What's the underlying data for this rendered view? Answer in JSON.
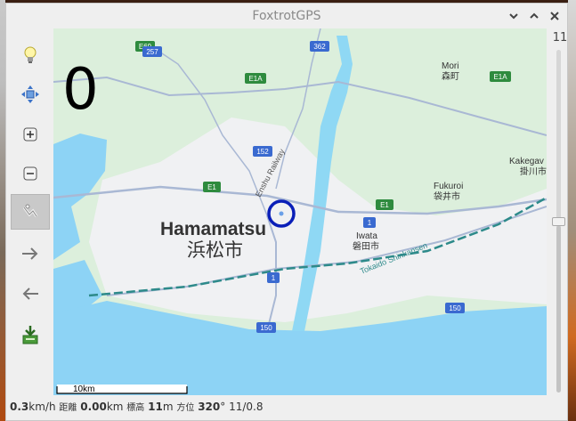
{
  "window": {
    "title": "FoxtrotGPS",
    "controls": [
      "minimize-icon",
      "maximize-icon",
      "close-icon"
    ]
  },
  "toolbar": {
    "items": [
      {
        "name": "bulb-icon"
      },
      {
        "name": "autocenter-icon"
      },
      {
        "name": "zoom-in-icon"
      },
      {
        "name": "zoom-out-icon"
      },
      {
        "name": "fullscreen-icon",
        "active": true
      },
      {
        "name": "forward-arrow-icon"
      },
      {
        "name": "back-arrow-icon"
      },
      {
        "name": "download-icon"
      }
    ]
  },
  "map": {
    "speed_overlay": "0",
    "scale_label": "10km",
    "labels": {
      "hamamatsu_en": "Hamamatsu",
      "hamamatsu_jp": "浜松市",
      "mori_en": "Mori",
      "mori_jp": "森町",
      "kakegawa_en": "Kakegav",
      "kakegawa_jp": "掛川市",
      "fukuroi_en": "Fukuroi",
      "fukuroi_jp": "袋井市",
      "iwata_en": "Iwata",
      "iwata_jp": "磐田市",
      "railway": "Enshu Railway",
      "shinkansen": "Tokaido Shinkansen"
    },
    "route_shields": {
      "r257": "257",
      "r362": "362",
      "r152": "152",
      "r150a": "150",
      "r150b": "150",
      "r1a": "1",
      "r1b": "1",
      "e69": "E69",
      "e1a": "E1A",
      "e1a2": "E1A",
      "e1": "E1",
      "e1b": "E1"
    },
    "colors": {
      "sea": "#8dd3f5",
      "land": "#dcefdc",
      "urban": "#f0f1f3",
      "river": "#8fd8f4",
      "marker": "#0a1fb8"
    }
  },
  "zoom": {
    "level_label": "11",
    "level_fraction": 0.5
  },
  "status": {
    "speed_value": "0.3",
    "speed_unit": "km/h",
    "distance_label": "距離",
    "distance_value": "0.00",
    "distance_unit": "km",
    "altitude_label": "標高",
    "altitude_value": "11",
    "altitude_unit": "m",
    "heading_label": "方位",
    "heading_value": "320",
    "heading_unit": "°",
    "satellites": "11/0.8"
  }
}
